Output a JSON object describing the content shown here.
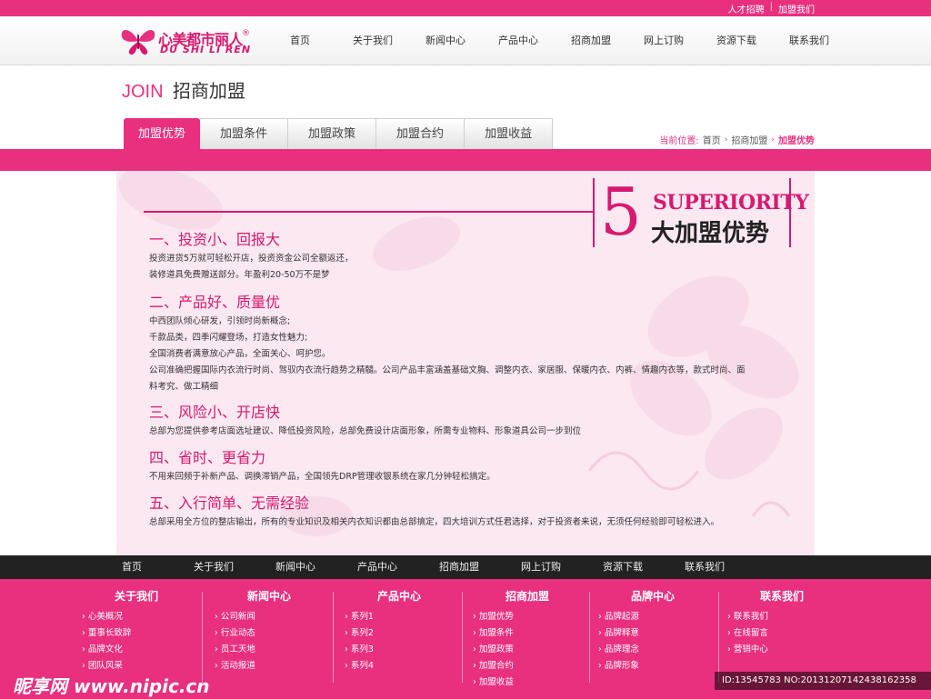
{
  "top_links": {
    "recruit": "人才招聘",
    "sep": "|",
    "join": "加盟我们"
  },
  "brand": {
    "cn": "心美都市丽人",
    "en": "DU SHI LI REN",
    "reg": "®"
  },
  "main_nav": [
    "首页",
    "关于我们",
    "新闻中心",
    "产品中心",
    "招商加盟",
    "网上订购",
    "资源下载",
    "联系我们"
  ],
  "page": {
    "title_en": "JOIN",
    "title_cn": "招商加盟"
  },
  "sub_tabs": [
    "加盟优势",
    "加盟条件",
    "加盟政策",
    "加盟合约",
    "加盟收益"
  ],
  "breadcrumb": {
    "label": "当前位置:",
    "home": "首页",
    "section": "招商加盟",
    "current": "加盟优势"
  },
  "banner": {
    "number": "5",
    "superiority": "SUPERIORITY",
    "title": "大加盟优势"
  },
  "sections": [
    {
      "title": "一、投资小、回报大",
      "lines": [
        "投资进货5万就可轻松开店，投资资金公司全额返还，",
        "装修道具免费赠送部分。年盈利20-50万不是梦"
      ]
    },
    {
      "title": "二、产品好、质量优",
      "lines": [
        "中西团队倾心研发，引领时尚新概念;",
        "千款品类，四季闪耀登场，打造女性魅力;",
        "全国消费者满意放心产品，全面关心、呵护您。",
        "公司准确把握国际内衣流行时尚、驾驭内衣流行趋势之精髓。公司产品丰富涵盖基础文胸、调整内衣、家居服、保暖内衣、内裤、情趣内衣等，款式时尚、面",
        "料考究、做工精细"
      ]
    },
    {
      "title": "三、风险小、开店快",
      "lines": [
        "总部为您提供参考店面选址建议、降低投资风险，总部免费设计店面形象，所需专业物料、形象道具公司一步到位"
      ]
    },
    {
      "title": "四、省时、更省力",
      "lines": [
        "不用来回频于补新产品、调换滞销产品，全国领先DRP管理收银系统在家几分钟轻松搞定。"
      ]
    },
    {
      "title": "五、入行简单、无需经验",
      "lines": [
        "总部采用全方位的整店输出，所有的专业知识及相关内衣知识都由总部搞定，四大培训方式任君选择，对于投资者来说，无须任何经验即可轻松进入。"
      ]
    }
  ],
  "bottom_nav": [
    "首页",
    "关于我们",
    "新闻中心",
    "产品中心",
    "招商加盟",
    "网上订购",
    "资源下载",
    "联系我们"
  ],
  "footer_cols": [
    {
      "title": "关于我们",
      "items": [
        "心美概况",
        "董事长致辞",
        "品牌文化",
        "团队风采"
      ]
    },
    {
      "title": "新闻中心",
      "items": [
        "公司新闻",
        "行业动态",
        "员工天地",
        "活动报道"
      ]
    },
    {
      "title": "产品中心",
      "items": [
        "系列1",
        "系列2",
        "系列3",
        "系列4"
      ]
    },
    {
      "title": "招商加盟",
      "items": [
        "加盟优势",
        "加盟条件",
        "加盟政策",
        "加盟合约",
        "加盟收益"
      ]
    },
    {
      "title": "品牌中心",
      "items": [
        "品牌起源",
        "品牌释意",
        "品牌理念",
        "品牌形象"
      ]
    },
    {
      "title": "联系我们",
      "items": [
        "联系我们",
        "在线留言",
        "营销中心"
      ]
    }
  ],
  "watermark": {
    "left": "昵享网 www.nipic.cn",
    "right": "ID:13545783 NO:20131207142438162358"
  },
  "colors": {
    "accent": "#e8307f",
    "dark": "#222222",
    "panel": "#fbe8f1"
  }
}
